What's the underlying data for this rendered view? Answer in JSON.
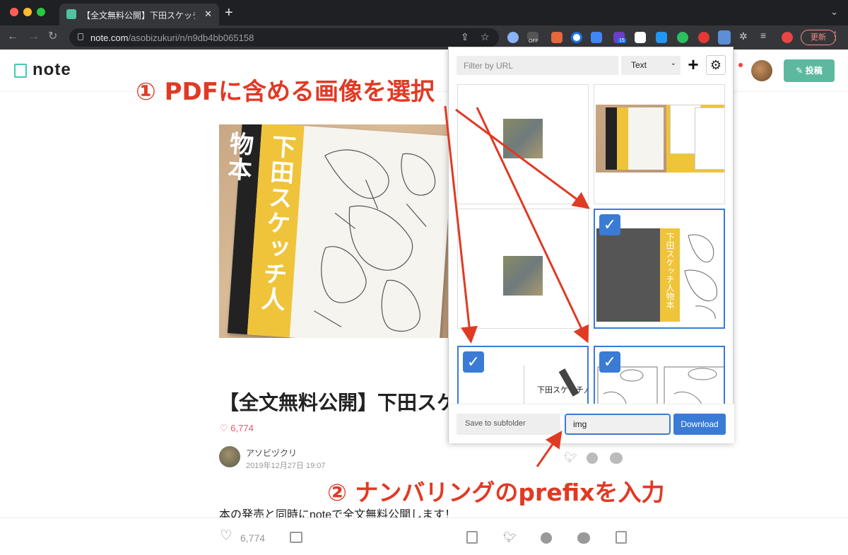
{
  "browser": {
    "tab_title": "【全文無料公開】下田スケッチ人物",
    "tab_close": "✕",
    "new_tab": "+",
    "url_host": "note.com",
    "url_path": "/asobizukuri/n/n9db4bb065158",
    "ext_off_badge": "OFF",
    "ext_count_badge": "15",
    "update_label": "更新",
    "colors": {
      "bg": "#1f2023",
      "toolbar": "#35363a",
      "update": "#f28b82"
    }
  },
  "note": {
    "logo": "note",
    "post_button": "投稿",
    "hero_band_text": "下田スケッチ人物本",
    "article_title": "【全文無料公開】下田スケッチ人物本",
    "likes": "6,774",
    "author_name": "アソビヅクリ",
    "author_date": "2019年12月27日 19:07",
    "body_excerpt": "本の発売と同時にnoteで全文無料公開します！",
    "bottom_likes": "6,774",
    "accent": "#41c9b4"
  },
  "popup": {
    "filter_placeholder": "Filter by URL",
    "mode_value": "Text",
    "add_label": "+",
    "settings_icon": "gear-icon",
    "subfolder_label": "Save to subfolder",
    "prefix_value": "img",
    "download_label": "Download",
    "thumb_band_text": "下田スケッチ人物本",
    "thumb_cover_text": "下田スケッチ人物本",
    "images": [
      {
        "selected": false
      },
      {
        "selected": false
      },
      {
        "selected": false
      },
      {
        "selected": true
      },
      {
        "selected": true
      },
      {
        "selected": true
      }
    ],
    "accent": "#3a7bd5"
  },
  "annotations": {
    "step1": "① PDFに含める画像を選択",
    "step2": "② ナンバリングのprefixを入力",
    "color": "#e03a25"
  }
}
